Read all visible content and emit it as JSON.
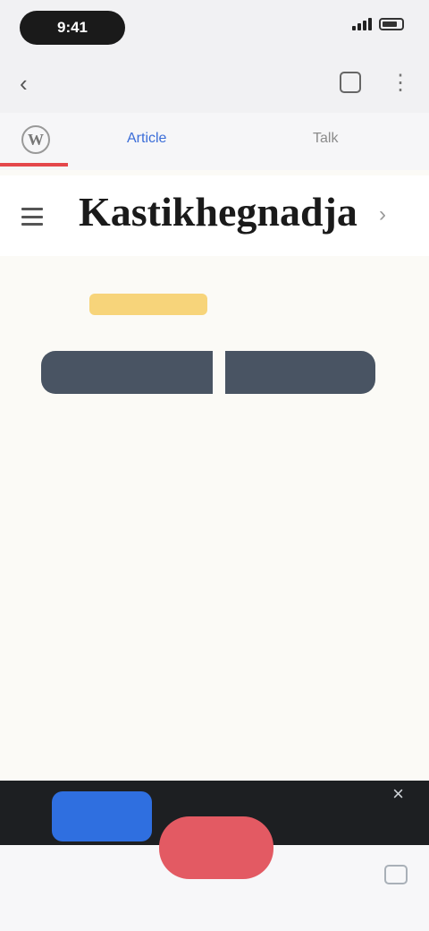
{
  "status_bar": {
    "time": "9:41"
  },
  "browser": {
    "url": ""
  },
  "wiki": {
    "tabs": [
      {
        "label": "Article"
      },
      {
        "label": "Talk"
      }
    ]
  },
  "page": {
    "title": "Kastikhegnadja",
    "badge": "",
    "badge_caption": "",
    "segment_left": "",
    "segment_right": ""
  },
  "body": {
    "paragraph": ""
  },
  "bottom": {
    "blue_button": "",
    "red_button": ""
  },
  "colors": {
    "accent_red": "#e4474b",
    "link_blue": "#3b6dd8",
    "segment_bg": "#495463",
    "primary_blue": "#2f6fe0",
    "fab_red": "#e35a63"
  },
  "icons": [
    "back-icon",
    "tabs-icon",
    "more-icon",
    "wikipedia-logo-icon",
    "menu-icon",
    "language-icon",
    "close-icon",
    "tabs-corner-icon"
  ]
}
